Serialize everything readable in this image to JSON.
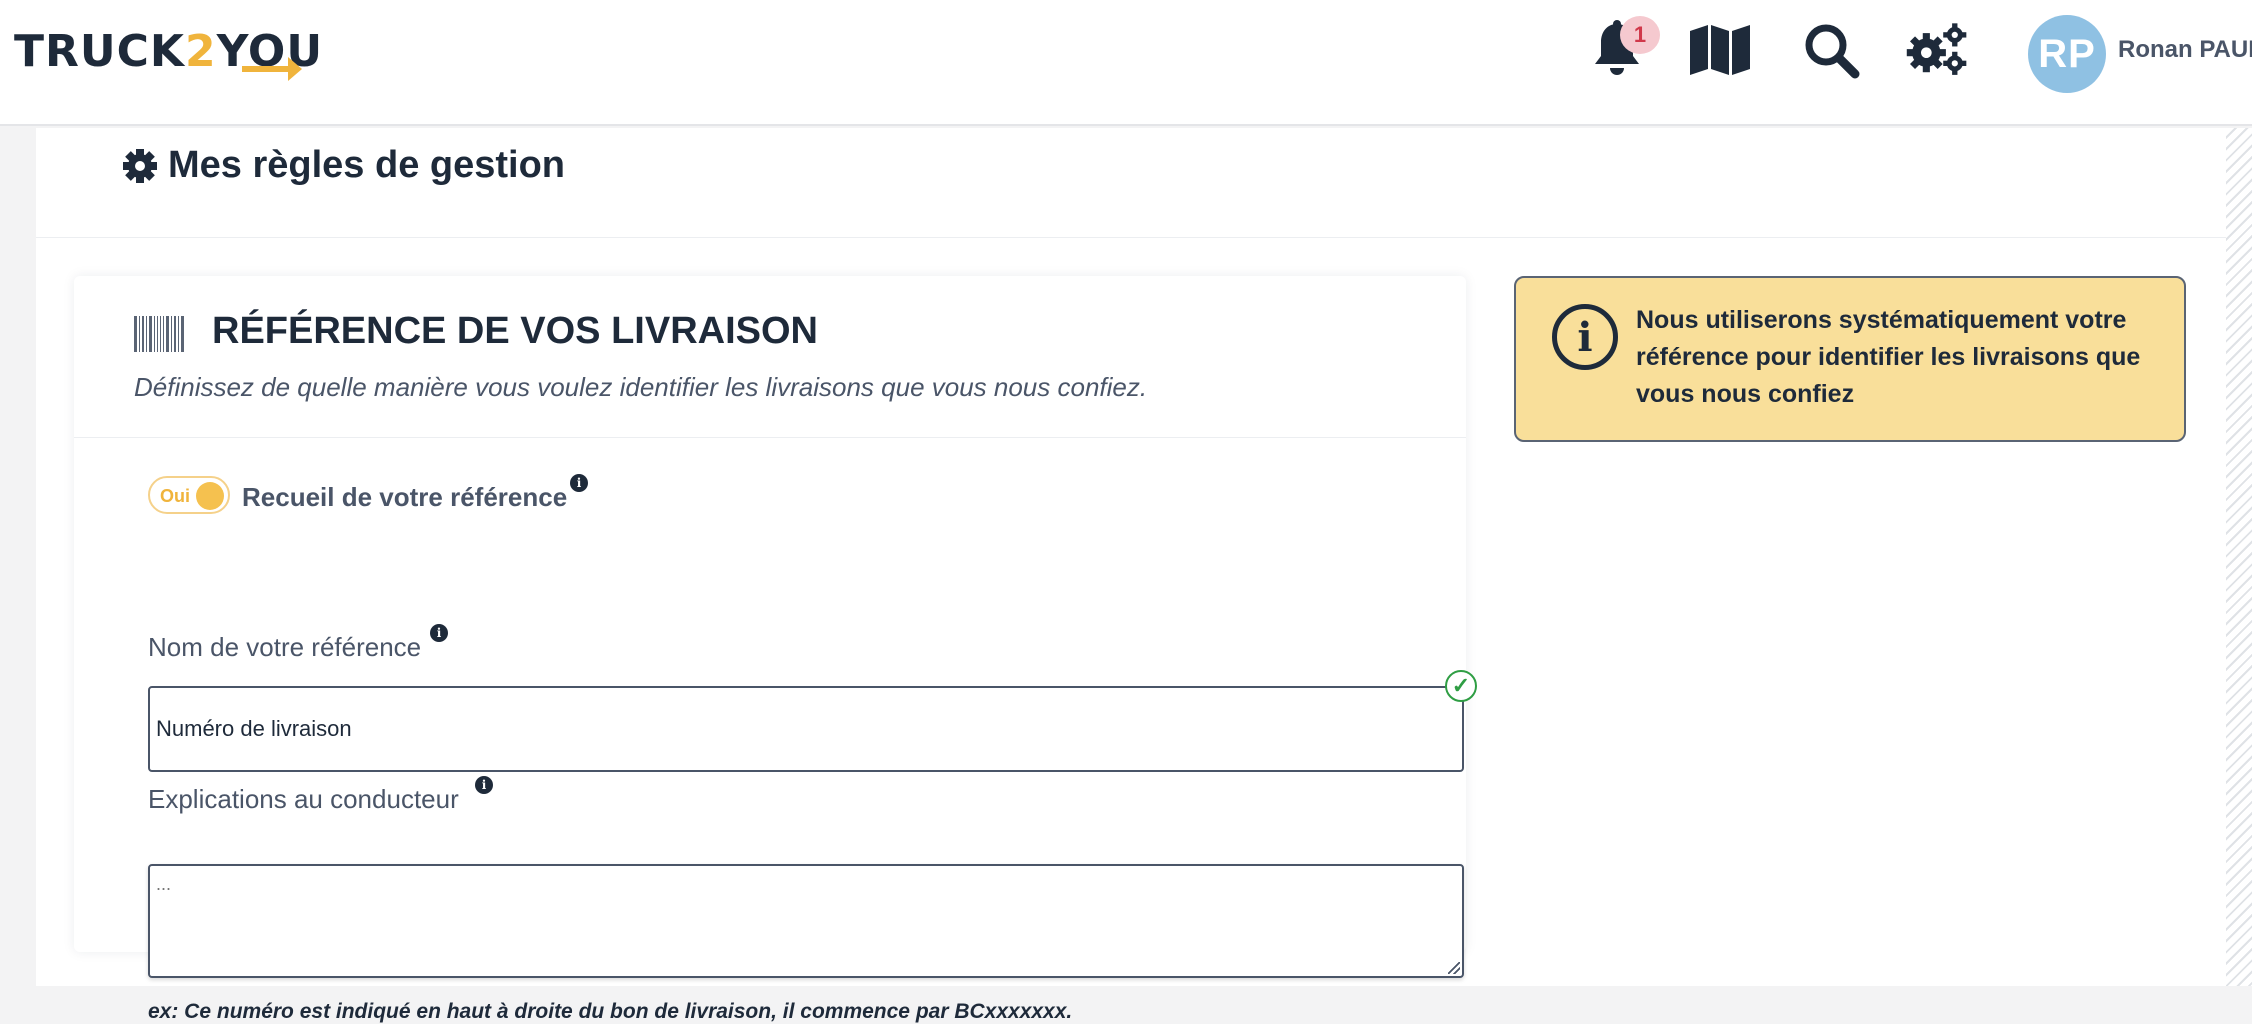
{
  "header": {
    "logo_part1": "TRUCK",
    "logo_part2": "2",
    "logo_part3": "YOU",
    "notification_count": "1",
    "avatar_initials": "RP",
    "user_name": "Ronan PAUL",
    "icons": [
      "bell-icon",
      "map-icon",
      "search-icon",
      "gears-icon"
    ]
  },
  "page": {
    "title": "Mes règles de gestion",
    "title_icon": "gear-icon"
  },
  "card": {
    "icon": "barcode-icon",
    "title": "RÉFÉRENCE DE VOS LIVRAISON",
    "subtitle": "Définissez de quelle manière vous voulez identifier les livraisons que vous nous confiez.",
    "toggle": {
      "label": "Oui",
      "state": "on"
    },
    "toggle_label": "Recueil de votre référence",
    "reference_name_label": "Nom de votre référence",
    "reference_name_value": "Numéro de livraison",
    "driver_explanation_label": "Explications au conducteur",
    "driver_explanation_placeholder": "...",
    "hint": "ex: Ce numéro est indiqué en haut à droite du bon de livraison, il commence par BCxxxxxxx."
  },
  "notice": {
    "icon": "info-circle-icon",
    "text": "Nous utiliserons systématiquement votre référence pour identifier les livraisons que vous nous confiez"
  },
  "colors": {
    "brand_dark": "#1e2a3a",
    "brand_accent": "#f0b43c",
    "notice_bg": "#f9df9a",
    "avatar_bg": "#8fc1e3",
    "badge_bg": "#f5c9cf",
    "valid_green": "#2f9e44"
  }
}
